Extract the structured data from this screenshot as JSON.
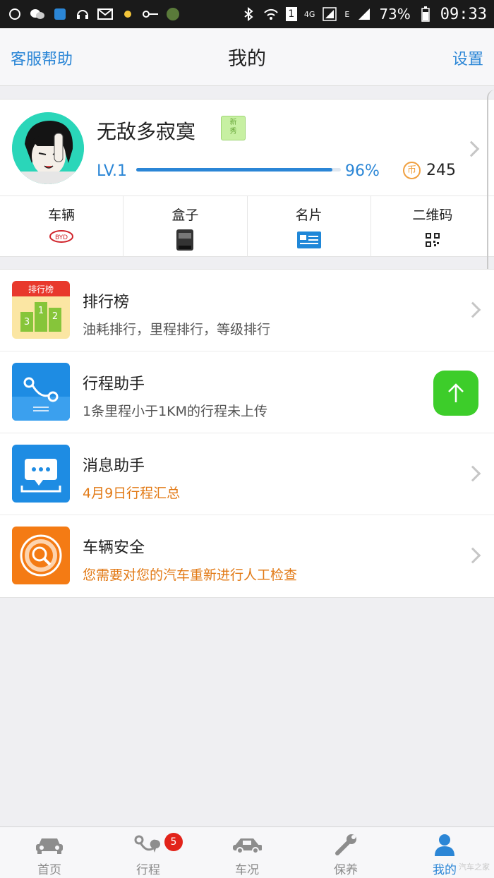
{
  "status_bar": {
    "time": "09:33",
    "battery": "73%",
    "network": "4G",
    "signal_label": "E",
    "sim_slot": "1"
  },
  "header": {
    "title": "我的",
    "left_link": "客服帮助",
    "right_link": "设置"
  },
  "profile": {
    "name": "无敌多寂寞",
    "badge": "新秀",
    "level": "LV.1",
    "progress": 0.96,
    "progress_text": "96%",
    "coins": "245",
    "coin_symbol": "币"
  },
  "quick_links": [
    {
      "label": "车辆",
      "icon": "byd-logo-icon"
    },
    {
      "label": "盒子",
      "icon": "obd-box-icon"
    },
    {
      "label": "名片",
      "icon": "business-card-icon"
    },
    {
      "label": "二维码",
      "icon": "qr-code-icon"
    }
  ],
  "menu": [
    {
      "title": "排行榜",
      "subtitle": "油耗排行，里程排行，等级排行",
      "icon": "leaderboard-icon",
      "ic_badge": "排行榜",
      "ranks": [
        "3",
        "1",
        "2"
      ]
    },
    {
      "title": "行程助手",
      "subtitle": "1条里程小于1KM的行程未上传",
      "icon": "trip-assistant-icon"
    },
    {
      "title": "消息助手",
      "subtitle": "4月9日行程汇总",
      "icon": "message-assistant-icon"
    },
    {
      "title": "车辆安全",
      "subtitle": "您需要对您的汽车重新进行人工检查",
      "icon": "vehicle-safety-icon"
    }
  ],
  "tabs": [
    {
      "label": "首页",
      "icon": "car-front-icon",
      "active": false
    },
    {
      "label": "行程",
      "icon": "route-icon",
      "active": false,
      "badge": "5"
    },
    {
      "label": "车况",
      "icon": "car-side-icon",
      "active": false
    },
    {
      "label": "保养",
      "icon": "wrench-icon",
      "active": false
    },
    {
      "label": "我的",
      "icon": "person-icon",
      "active": true
    }
  ],
  "colors": {
    "accent": "#2b86d6",
    "orange": "#e27a16",
    "green": "#3dcd2a",
    "badge_red": "#e2231a"
  },
  "watermark": "汽车之家"
}
